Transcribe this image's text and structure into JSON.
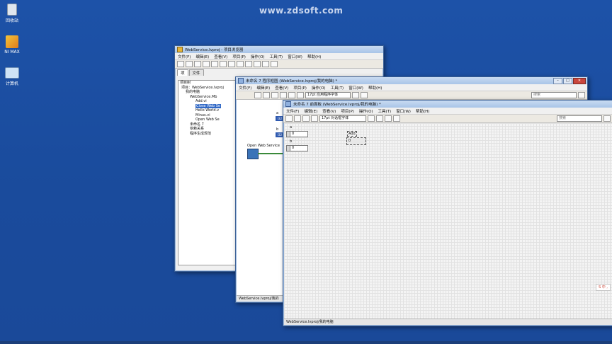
{
  "watermark": "www.zdsoft.com",
  "desktop": {
    "icons": [
      {
        "label": "回收站",
        "icon": "recycle-bin-icon"
      },
      {
        "label": "NI MAX",
        "icon": "ni-max-icon"
      },
      {
        "label": "计算机",
        "icon": "computer-icon"
      }
    ]
  },
  "project_window": {
    "title": "WebService.lvproj - 项目浏览器",
    "menu": [
      "文件(F)",
      "编辑(E)",
      "查看(V)",
      "项目(P)",
      "操作(O)",
      "工具(T)",
      "窗口(W)",
      "帮助(H)"
    ],
    "tabs": [
      "项",
      "文件"
    ],
    "tree": [
      "项目树",
      "项目：WebService.lvproj",
      "我的电脑",
      "WebService.Mb",
      "Add.vi",
      "Close Web Se",
      "Hello World.v",
      "Minus.vi",
      "Open Web Se",
      "未命名 7",
      "依赖关系",
      "程序生成规范"
    ]
  },
  "block_diagram": {
    "title": "未命名 7 程序框图 (WebService.lvproj/我的电脑) *",
    "menu": [
      "文件(F)",
      "编辑(E)",
      "查看(V)",
      "项目(P)",
      "操作(O)",
      "工具(T)",
      "窗口(W)",
      "帮助(H)"
    ],
    "font_select": "17pt 应用程序字体",
    "search_placeholder": "搜索",
    "terminals": [
      "a",
      "b"
    ],
    "terminal_type": "I32",
    "node_label": "Open Web Service",
    "status": "WebService.lvproj/我的"
  },
  "front_panel": {
    "title": "未命名 7 前面板 (WebService.lvproj/我的电脑) *",
    "menu": [
      "文件(F)",
      "编辑(E)",
      "查看(V)",
      "项目(P)",
      "操作(O)",
      "工具(T)",
      "窗口(W)",
      "帮助(H)"
    ],
    "font_select": "17pt 对话框字体",
    "search_placeholder": "搜索",
    "controls": [
      {
        "label": "a",
        "value": "0"
      },
      {
        "label": "b",
        "value": "0"
      }
    ],
    "indicator": {
      "label": "Add",
      "value": "0"
    },
    "status": "WebService.lvproj/我的电脑",
    "ime": "S 中 ,"
  },
  "colors": {
    "desktop": "#1c4fa3",
    "titlebar": "#b9d1ee",
    "selection": "#3169c6"
  }
}
